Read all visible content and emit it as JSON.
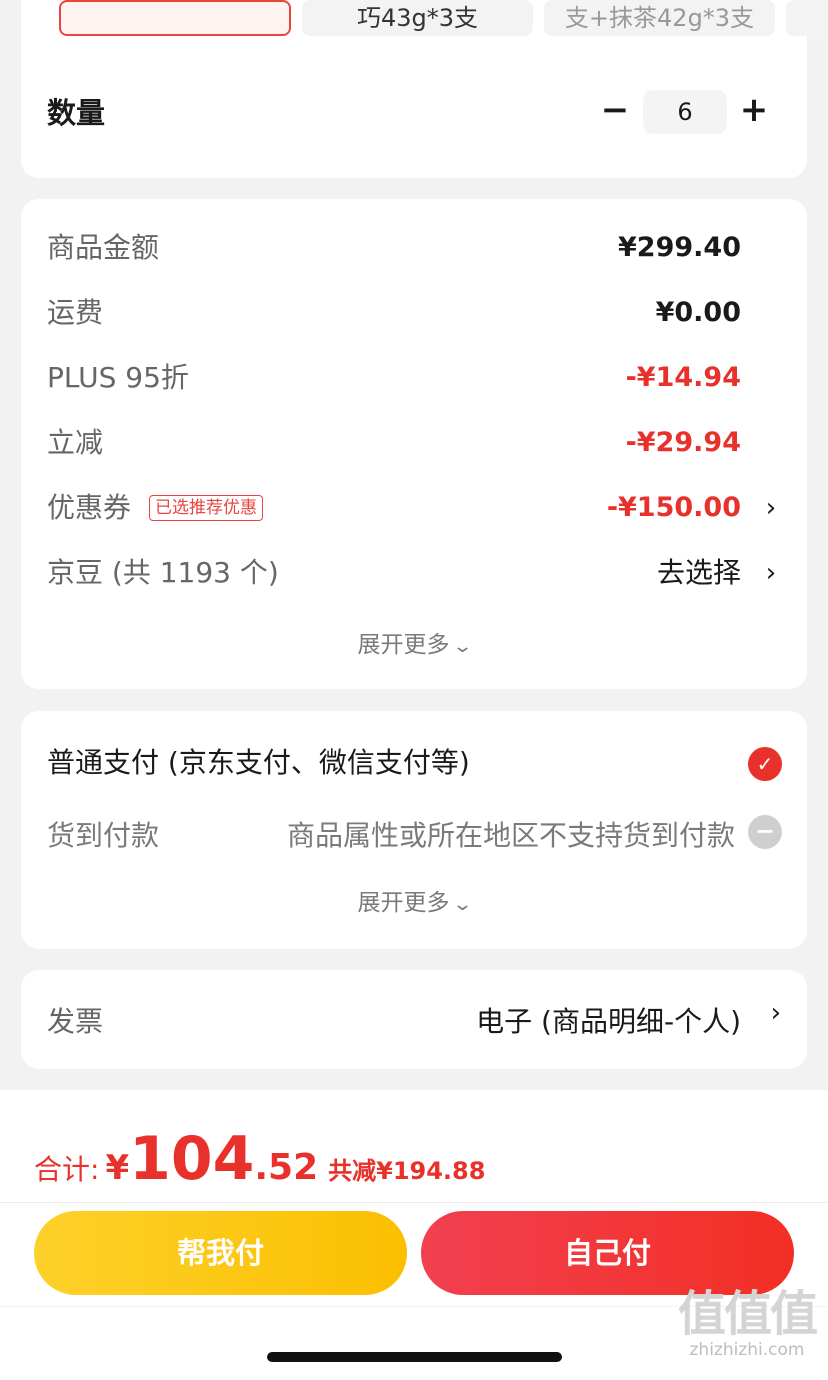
{
  "spec": {
    "options": [
      "",
      "巧43g*3支",
      "支+抹茶42g*3支",
      ""
    ]
  },
  "quantity": {
    "label": "数量",
    "minus": "−",
    "value": "6",
    "plus": "+"
  },
  "price": {
    "rows": [
      {
        "label": "商品金额",
        "value": "¥299.40"
      },
      {
        "label": "运费",
        "value": "¥0.00"
      },
      {
        "label": "PLUS 95折",
        "value": "-¥14.94"
      },
      {
        "label": "立减",
        "value": "-¥29.94"
      },
      {
        "label": "优惠券",
        "tag": "已选推荐优惠",
        "value": "-¥150.00"
      },
      {
        "label": "京豆 (共 1193 个)",
        "value": "去选择"
      }
    ],
    "expand": "展开更多"
  },
  "payment": {
    "main": "普通支付 (京东支付、微信支付等)",
    "cod_label": "货到付款",
    "cod_note": "商品属性或所在地区不支持货到付款",
    "expand": "展开更多"
  },
  "invoice": {
    "label": "发票",
    "value": "电子 (商品明细-个人)"
  },
  "total": {
    "label": "合计:",
    "currency": "¥",
    "integer": "104",
    "decimal": ".52",
    "saved": "共减¥194.88"
  },
  "buttons": {
    "help_pay": "帮我付",
    "self_pay": "自己付"
  },
  "watermark": {
    "logo": "值值值",
    "url": "zhizhizhi.com"
  },
  "icons": {
    "chevron": "chevron-right-icon",
    "check": "check-circle-icon",
    "disabled": "minus-circle-icon"
  },
  "colors": {
    "accent": "#e8312a",
    "yellow": "#fbbf00"
  }
}
